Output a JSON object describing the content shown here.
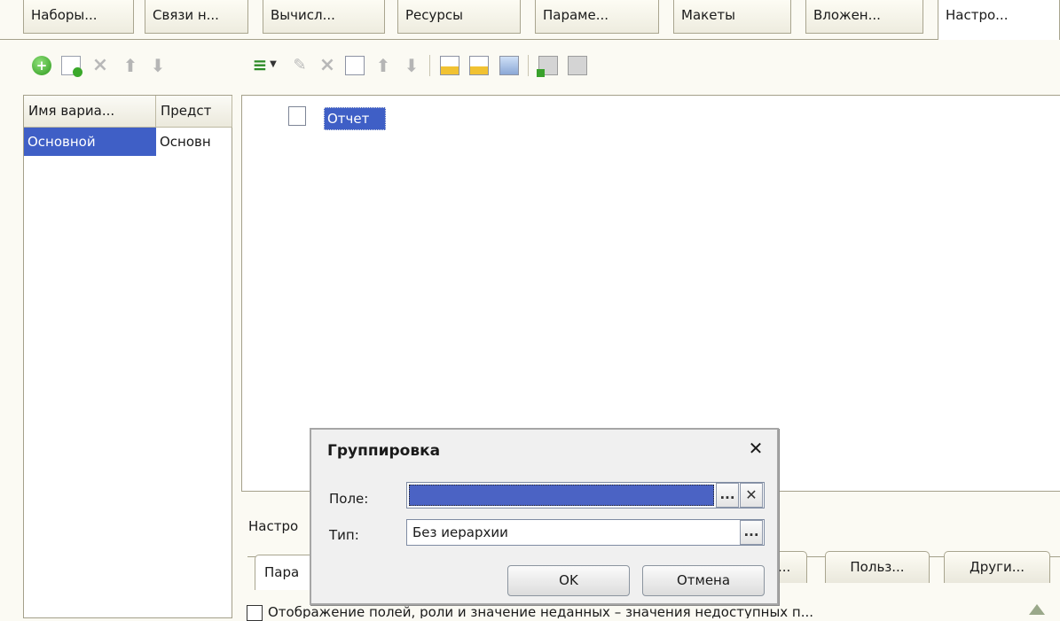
{
  "tabs": [
    {
      "label": "Наборы..."
    },
    {
      "label": "Связи н..."
    },
    {
      "label": "Вычисл..."
    },
    {
      "label": "Ресурсы"
    },
    {
      "label": "Параме..."
    },
    {
      "label": "Макеты"
    },
    {
      "label": "Вложен..."
    },
    {
      "label": "Настро..."
    }
  ],
  "active_tab_index": 7,
  "variants_table": {
    "columns": [
      "Имя вариа...",
      "Предст"
    ],
    "rows": [
      [
        "Основной",
        "Основн"
      ]
    ]
  },
  "structure_tree": {
    "items": [
      {
        "label": "Отчет",
        "icon": "document-icon",
        "selected": true
      }
    ]
  },
  "settings_area": {
    "label": "Настро",
    "tabs": [
      {
        "label": "Пара"
      },
      {
        "label": "..."
      },
      {
        "label": "Польз..."
      },
      {
        "label": "Други..."
      }
    ],
    "checkbox_label": "Отображение полей, роли и значение неданных – значения недоступных п..."
  },
  "dialog": {
    "title": "Группировка",
    "field_label": "Поле:",
    "field_value": "",
    "type_label": "Тип:",
    "type_value": "Без иерархии",
    "ok_label": "OK",
    "cancel_label": "Отмена",
    "close_glyph": "✕",
    "ellipsis": "..."
  },
  "colors": {
    "selection": "#3f5fc6",
    "field_highlight": "#4b63c4",
    "background": "#fbfaf3",
    "dialog_bg": "#f0f0f0"
  }
}
